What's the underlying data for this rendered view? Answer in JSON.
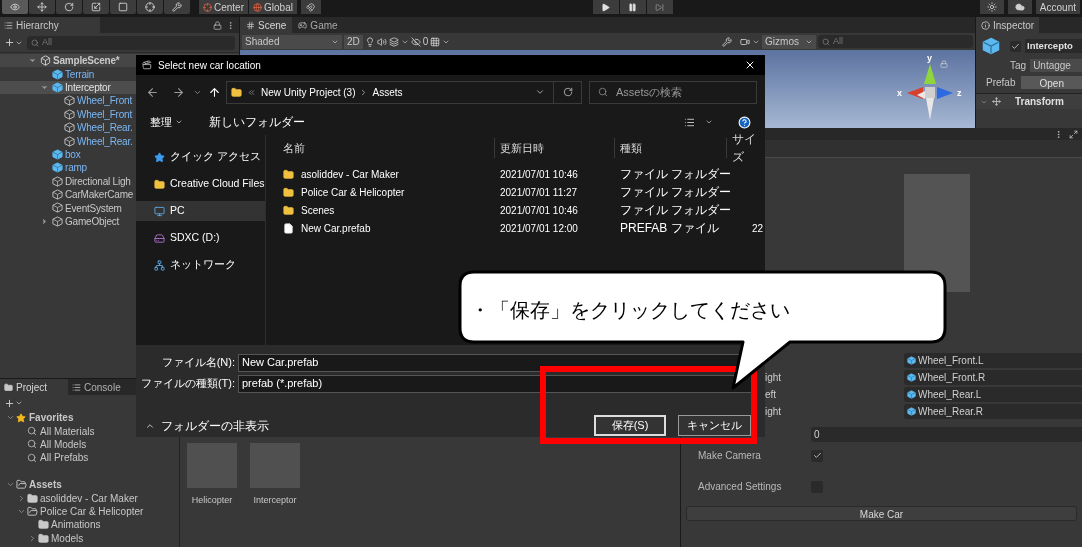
{
  "toolbar": {
    "tools": [
      {
        "kind": "view",
        "selected": true
      },
      {
        "kind": "move",
        "selected": false
      },
      {
        "kind": "rotate",
        "selected": false
      },
      {
        "kind": "scale",
        "selected": false
      },
      {
        "kind": "rect",
        "selected": false
      },
      {
        "kind": "transform",
        "selected": false
      },
      {
        "kind": "custom",
        "selected": false
      }
    ],
    "pivot": "Center",
    "space": "Global",
    "account": "Account"
  },
  "hierarchy": {
    "tab": "Hierarchy",
    "search_placeholder": "All",
    "items": [
      {
        "label": "SampleScene*",
        "kind": "scene",
        "expanded": true,
        "selected": false,
        "children": [
          {
            "label": "Terrain",
            "kind": "prefab",
            "selected": false
          },
          {
            "label": "Interceptor",
            "kind": "prefab",
            "expanded": true,
            "selected": true,
            "children": [
              {
                "label": "Wheel_Front",
                "kind": "prefab_part",
                "selected": false
              },
              {
                "label": "Wheel_Front",
                "kind": "prefab_part",
                "selected": false
              },
              {
                "label": "Wheel_Rear.",
                "kind": "prefab_part",
                "selected": false
              },
              {
                "label": "Wheel_Rear.",
                "kind": "prefab_part",
                "selected": false
              }
            ]
          },
          {
            "label": "box",
            "kind": "prefab",
            "selected": false
          },
          {
            "label": "ramp",
            "kind": "prefab",
            "selected": false
          },
          {
            "label": "Directional Ligh",
            "kind": "object",
            "selected": false
          },
          {
            "label": "CarMakerCame",
            "kind": "object",
            "selected": false
          },
          {
            "label": "EventSystem",
            "kind": "object",
            "selected": false
          },
          {
            "label": "GameObject",
            "kind": "object",
            "expanded": false,
            "selected": false
          }
        ]
      }
    ]
  },
  "scene": {
    "tabs": [
      {
        "label": "Scene",
        "kind": "scene",
        "selected": true
      },
      {
        "label": "Game",
        "kind": "game",
        "selected": false
      }
    ],
    "shading": "Shaded",
    "mode_2d": "2D",
    "hidden_count": "0",
    "gizmos": "Gizmos",
    "search_placeholder": "All",
    "axis_labels": {
      "top": "y",
      "left": "x",
      "right": "z"
    }
  },
  "inspector": {
    "tab": "Inspector",
    "active": true,
    "name": "Intercepto",
    "tag_label": "Tag",
    "tag": "Untagge",
    "prefab_label": "Prefab",
    "open_button": "Open",
    "component": "Transform"
  },
  "project": {
    "tabs": [
      {
        "label": "Project",
        "kind": "project",
        "selected": true
      },
      {
        "label": "Console",
        "kind": "console",
        "selected": false
      }
    ],
    "tree": [
      {
        "label": "Favorites",
        "kind": "favorites",
        "expanded": true,
        "children": [
          {
            "label": "All Materials",
            "kind": "search"
          },
          {
            "label": "All Models",
            "kind": "search"
          },
          {
            "label": "All Prefabs",
            "kind": "search"
          }
        ]
      },
      {
        "label": "Assets",
        "kind": "folder",
        "expanded": true,
        "children": [
          {
            "label": "asoliddev - Car Maker",
            "kind": "folder",
            "expanded": false
          },
          {
            "label": "Police Car & Helicopter",
            "kind": "folder",
            "expanded": true,
            "children": [
              {
                "label": "Animations",
                "kind": "folder"
              },
              {
                "label": "Models",
                "kind": "folder",
                "expanded": false
              }
            ]
          }
        ]
      }
    ],
    "assets": [
      {
        "name": "Helicopter"
      },
      {
        "name": "Interceptor"
      }
    ]
  },
  "car_maker": {
    "rows": [
      {
        "kind": "object",
        "value": "Wheel_Front.L"
      },
      {
        "kind": "object",
        "label": "ight",
        "value": "Wheel_Front.R"
      },
      {
        "kind": "object",
        "label": "eft",
        "value": "Wheel_Rear.L"
      },
      {
        "kind": "object",
        "label": "ight",
        "value": "Wheel_Rear.R"
      },
      {
        "kind": "number",
        "value": "0"
      },
      {
        "kind": "toggle",
        "label": "Make Camera",
        "checked": true
      },
      {
        "kind": "toggle",
        "label": "Advanced Settings",
        "checked": false
      }
    ],
    "button": "Make Car"
  },
  "dialog": {
    "title": "Select new car location",
    "path": [
      "New Unity Project (3)",
      "Assets"
    ],
    "search_placeholder": "Assetsの検索",
    "organize": "整理",
    "new_folder": "新しいフォルダー",
    "nav": [
      {
        "label": "クイック アクセス",
        "kind": "quick",
        "selected": false
      },
      {
        "label": "Creative Cloud Files",
        "kind": "cloud",
        "selected": false
      },
      {
        "label": "PC",
        "kind": "pc",
        "selected": true
      },
      {
        "label": "SDXC (D:)",
        "kind": "drive",
        "selected": false
      },
      {
        "label": "ネットワーク",
        "kind": "network",
        "selected": false
      }
    ],
    "columns": [
      "名前",
      "更新日時",
      "種類",
      "サイズ"
    ],
    "files": [
      {
        "kind": "folder",
        "name": "asoliddev - Car Maker",
        "modified": "2021/07/01 10:46",
        "type": "ファイル フォルダー"
      },
      {
        "kind": "folder",
        "name": "Police Car & Helicopter",
        "modified": "2021/07/01 11:27",
        "type": "ファイル フォルダー"
      },
      {
        "kind": "folder",
        "name": "Scenes",
        "modified": "2021/07/01 10:46",
        "type": "ファイル フォルダー"
      },
      {
        "kind": "file",
        "name": "New Car.prefab",
        "modified": "2021/07/01 12:00",
        "type": "PREFAB ファイル",
        "size": "22"
      }
    ],
    "filename_label": "ファイル名(N):",
    "filename": "New Car.prefab",
    "filetype_label": "ファイルの種類(T):",
    "filetype": "prefab (*.prefab)",
    "hide_folders": "フォルダーの非表示",
    "save": "保存(S)",
    "cancel": "キャンセル"
  },
  "callout": {
    "text": "・「保存」をクリックしてください"
  }
}
